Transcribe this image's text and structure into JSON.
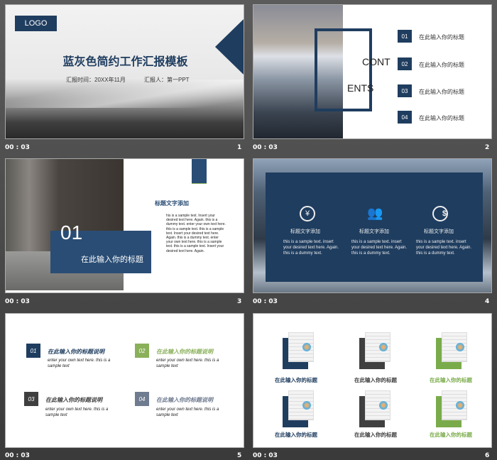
{
  "slides": [
    {
      "number": "1",
      "time": "00 : 03",
      "logo": "LOGO",
      "title": "蓝灰色简约工作汇报模板",
      "date": "汇报时间：20XX年11月",
      "reporter": "汇报人：第一PPT"
    },
    {
      "number": "2",
      "time": "00 : 03",
      "word1": "CONT",
      "word2": "ENTS",
      "items": [
        {
          "num": "01",
          "label": "在此输入你的标题"
        },
        {
          "num": "02",
          "label": "在此输入你的标题"
        },
        {
          "num": "03",
          "label": "在此输入你的标题"
        },
        {
          "num": "04",
          "label": "在此输入你的标题"
        }
      ]
    },
    {
      "number": "3",
      "time": "00 : 03",
      "big_num": "01",
      "box_title": "在此输入你的标题",
      "heading": "标题文字添加",
      "body": "his is a sample text. Insert your desired text here. Again. this is a dummy text. enter your own text here. this is a sample text. this is a sample text. Insert your desired text here. Again. this is a dummy text. enter your own text here. this is a sample text. this is a sample text. Insert your desired text here. Again."
    },
    {
      "number": "4",
      "time": "00 : 03",
      "cols": [
        {
          "icon": "yen-coin-icon",
          "title": "标题文字添加",
          "text": "this is a sample text. insert your desired text here. Again. this is a dummy text."
        },
        {
          "icon": "team-icon",
          "title": "标题文字添加",
          "text": "this is a sample text. insert your desired text here. Again. this is a dummy text."
        },
        {
          "icon": "clock-dollar-icon",
          "title": "标题文字添加",
          "text": "this is a sample text. insert your desired text here. Again. this is a dummy text."
        }
      ]
    },
    {
      "number": "5",
      "time": "00 : 03",
      "items": [
        {
          "num": "01",
          "title": "在此输入你的标题说明",
          "text": "enter your own text here. this is a sample text",
          "color": "#1f3d5f"
        },
        {
          "num": "02",
          "title": "在此输入你的标题说明",
          "text": "enter your own text here. this is a sample text",
          "color": "#8ab05a"
        },
        {
          "num": "03",
          "title": "在此输入你的标题说明",
          "text": "enter your own text here. this is a sample text",
          "color": "#3f3f3f"
        },
        {
          "num": "04",
          "title": "在此输入你的标题说明",
          "text": "enter your own text here. this is a sample text",
          "color": "#6f7b8f"
        }
      ]
    },
    {
      "number": "6",
      "time": "00 : 03",
      "items": [
        {
          "label": "在此输入你的标题",
          "color": "#1f3d5f"
        },
        {
          "label": "在此输入你的标题",
          "color": "#404040"
        },
        {
          "label": "在此输入你的标题",
          "color": "#7aab4a"
        },
        {
          "label": "在此输入你的标题",
          "color": "#1f3d5f"
        },
        {
          "label": "在此输入你的标题",
          "color": "#404040"
        },
        {
          "label": "在此输入你的标题",
          "color": "#7aab4a"
        }
      ]
    }
  ]
}
